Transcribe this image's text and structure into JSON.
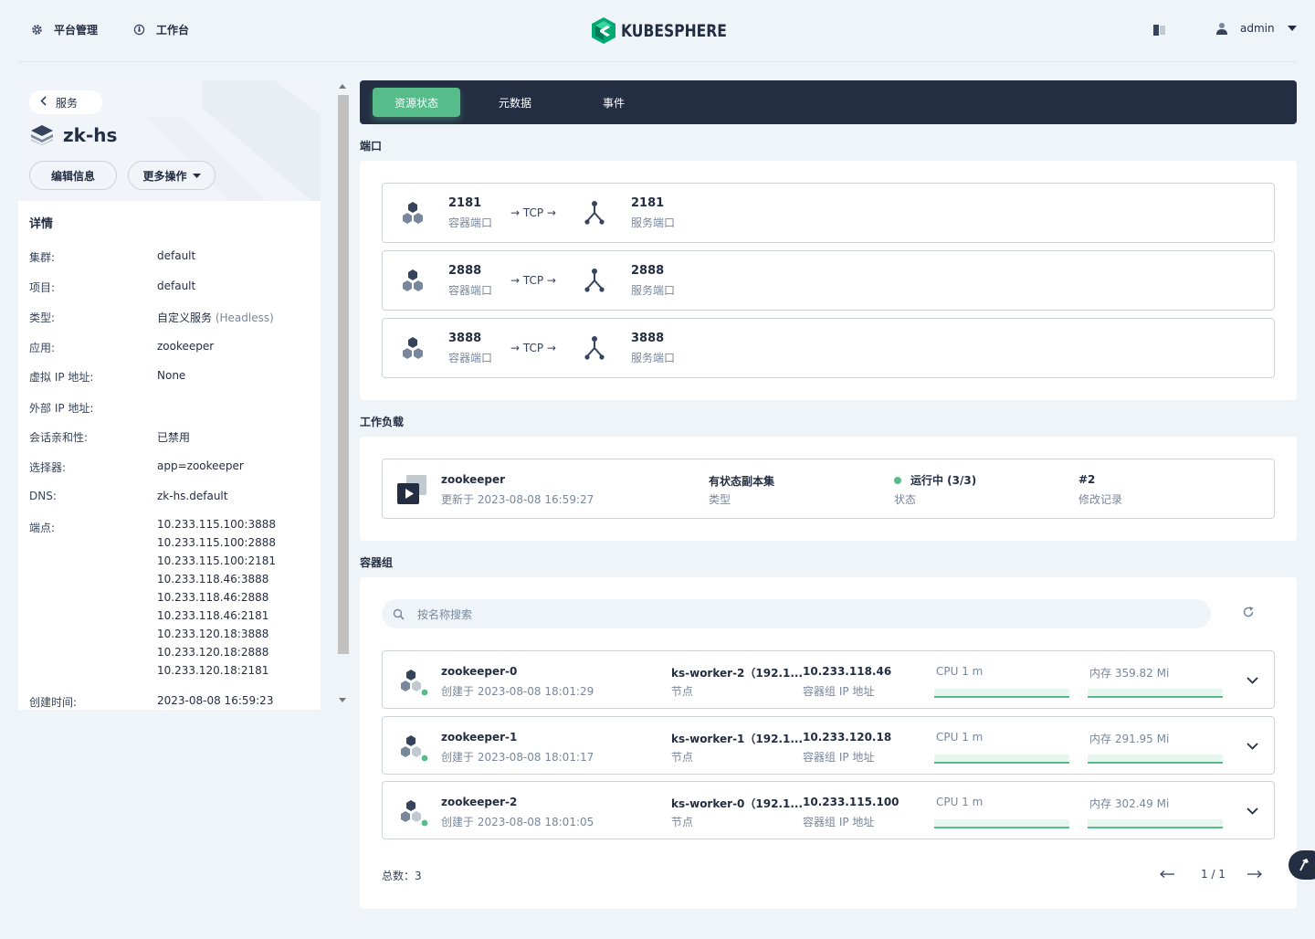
{
  "header": {
    "platform_label": "平台管理",
    "workbench_label": "工作台",
    "logo_text": "KUBESPHERE",
    "user_name": "admin"
  },
  "detail": {
    "back_label": "服务",
    "service_name": "zk-hs",
    "edit_button": "编辑信息",
    "more_button": "更多操作",
    "section_title": "详情",
    "rows": [
      {
        "key": "集群:",
        "value": "default"
      },
      {
        "key": "项目:",
        "value": "default"
      },
      {
        "key": "类型:",
        "value": "自定义服务",
        "extra": "(Headless)"
      },
      {
        "key": "应用:",
        "value": "zookeeper"
      },
      {
        "key": "虚拟 IP 地址:",
        "value": "None"
      },
      {
        "key": "外部 IP 地址:",
        "value": ""
      },
      {
        "key": "会话亲和性:",
        "value": "已禁用"
      },
      {
        "key": "选择器:",
        "value": "app=zookeeper"
      },
      {
        "key": "DNS:",
        "value": "zk-hs.default"
      },
      {
        "key": "端点:",
        "value": ""
      }
    ],
    "endpoints": [
      "10.233.115.100:3888",
      "10.233.115.100:2888",
      "10.233.115.100:2181",
      "10.233.118.46:3888",
      "10.233.118.46:2888",
      "10.233.118.46:2181",
      "10.233.120.18:3888",
      "10.233.120.18:2888",
      "10.233.120.18:2181"
    ],
    "created_key": "创建时间:",
    "created_value": "2023-08-08 16:59:23"
  },
  "tabs": [
    "资源状态",
    "元数据",
    "事件"
  ],
  "ports": {
    "title": "端口",
    "items": [
      {
        "container_port": "2181",
        "container_label": "容器端口",
        "protocol": "→ TCP →",
        "service_port": "2181",
        "service_label": "服务端口"
      },
      {
        "container_port": "2888",
        "container_label": "容器端口",
        "protocol": "→ TCP →",
        "service_port": "2888",
        "service_label": "服务端口"
      },
      {
        "container_port": "3888",
        "container_label": "容器端口",
        "protocol": "→ TCP →",
        "service_port": "3888",
        "service_label": "服务端口"
      }
    ]
  },
  "workload": {
    "title": "工作负载",
    "name": "zookeeper",
    "updated": "更新于 2023-08-08 16:59:27",
    "type_value": "有状态副本集",
    "type_label": "类型",
    "status_value": "运行中 (3/3)",
    "status_label": "状态",
    "revision_value": "#2",
    "revision_label": "修改记录"
  },
  "pods": {
    "title": "容器组",
    "search_placeholder": "按名称搜索",
    "items": [
      {
        "name": "zookeeper-0",
        "created": "创建于 2023-08-08 18:01:29",
        "node": "ks-worker-2（192.1...",
        "node_label": "节点",
        "ip": "10.233.118.46",
        "ip_label": "容器组 IP 地址",
        "cpu": "CPU 1 m",
        "mem": "内存 359.82 Mi"
      },
      {
        "name": "zookeeper-1",
        "created": "创建于 2023-08-08 18:01:17",
        "node": "ks-worker-1（192.1...",
        "node_label": "节点",
        "ip": "10.233.120.18",
        "ip_label": "容器组 IP 地址",
        "cpu": "CPU 1 m",
        "mem": "内存 291.95 Mi"
      },
      {
        "name": "zookeeper-2",
        "created": "创建于 2023-08-08 18:01:05",
        "node": "ks-worker-0（192.1...",
        "node_label": "节点",
        "ip": "10.233.115.100",
        "ip_label": "容器组 IP 地址",
        "cpu": "CPU 1 m",
        "mem": "内存 302.49 Mi"
      }
    ],
    "total": "总数：3",
    "page": "1 / 1"
  },
  "colors": {
    "accent": "#55bc8a",
    "dark": "#242e42"
  }
}
